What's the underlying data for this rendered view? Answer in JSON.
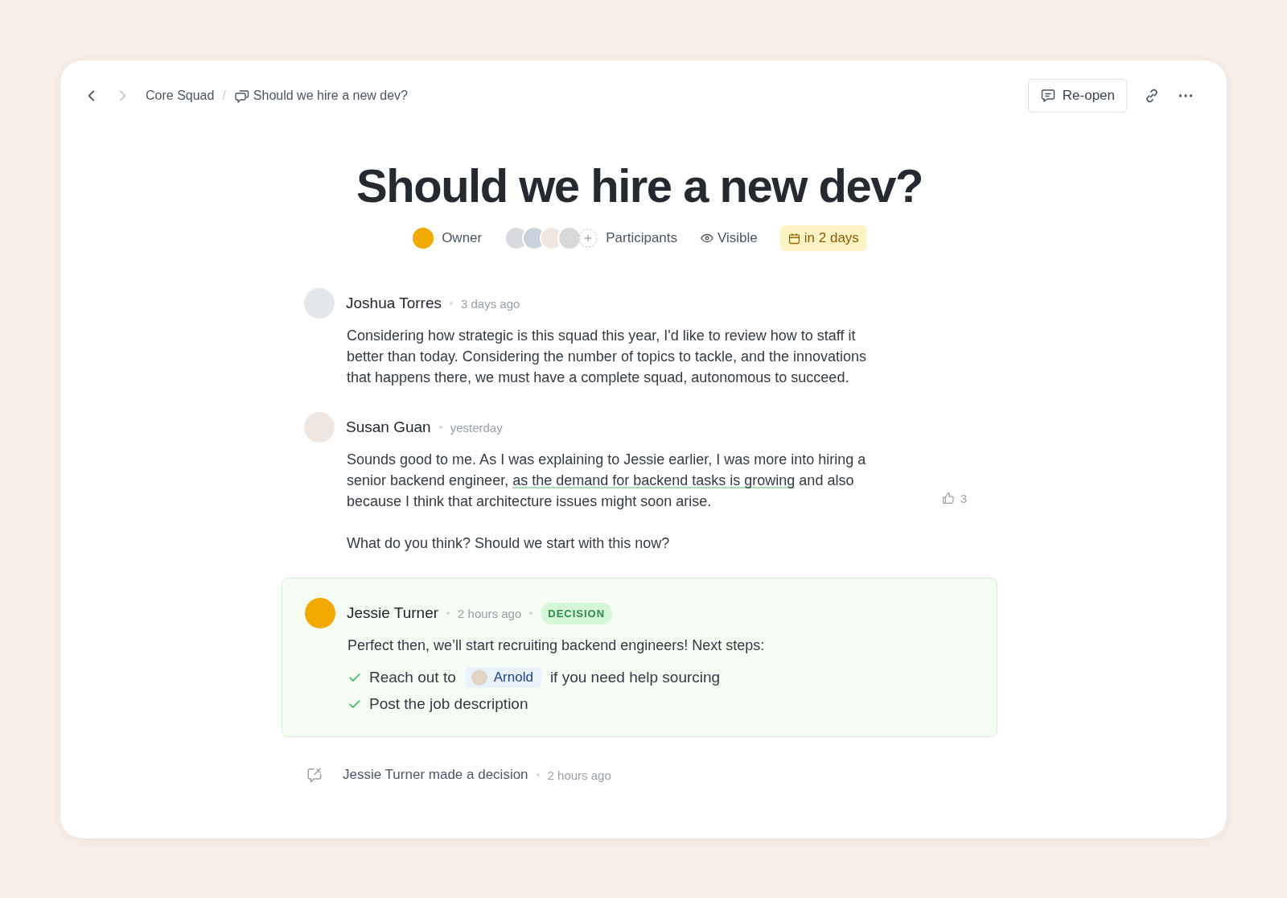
{
  "breadcrumb": {
    "items": [
      "Core Squad",
      "Should we hire a new dev?"
    ],
    "separator": "/"
  },
  "actions": {
    "reopen": "Re-open"
  },
  "title": "Should we hire a new dev?",
  "meta": {
    "owner": "Owner",
    "participants_label": "Participants",
    "visibility": "Visible",
    "due": "in 2 days"
  },
  "comments": [
    {
      "author": "Joshua Torres",
      "time": "3 days ago",
      "decision": false,
      "paragraphs": [
        [
          {
            "text": "Considering how strategic is this squad this year, I'd like to review how to staff it better than today. Considering the number of topics to tackle, and the innovations that happens there, we must have a complete squad, autonomous to succeed.",
            "highlighted": false
          }
        ]
      ]
    },
    {
      "author": "Susan Guan",
      "time": "yesterday",
      "decision": false,
      "likes": "3",
      "paragraphs": [
        [
          {
            "text": "Sounds good to me. As I was explaining to Jessie earlier, I was more into hiring a senior backend engineer, ",
            "highlighted": false
          },
          {
            "text": "as the demand for backend tasks is growing",
            "highlighted": true
          },
          {
            "text": " and also because I think that architecture issues might soon arise.",
            "highlighted": false
          }
        ],
        [
          {
            "text": "What do you think? Should we start with this now?",
            "highlighted": false
          }
        ]
      ]
    },
    {
      "author": "Jessie Turner",
      "time": "2 hours ago",
      "decision": true,
      "badge": "DECISION",
      "paragraphs": [
        [
          {
            "text": "Perfect then, we’ll start recruiting backend engineers! Next steps:",
            "highlighted": false
          }
        ]
      ],
      "steps": [
        {
          "done": true,
          "parts": [
            {
              "kind": "text",
              "text": "Reach out to"
            },
            {
              "kind": "mention",
              "text": "Arnold"
            },
            {
              "kind": "text",
              "text": "if you need help sourcing"
            }
          ]
        },
        {
          "done": true,
          "parts": [
            {
              "kind": "text",
              "text": "Post the job description"
            }
          ]
        }
      ]
    }
  ],
  "activity": {
    "text": "Jessie Turner made a decision",
    "time": "2 hours ago"
  }
}
